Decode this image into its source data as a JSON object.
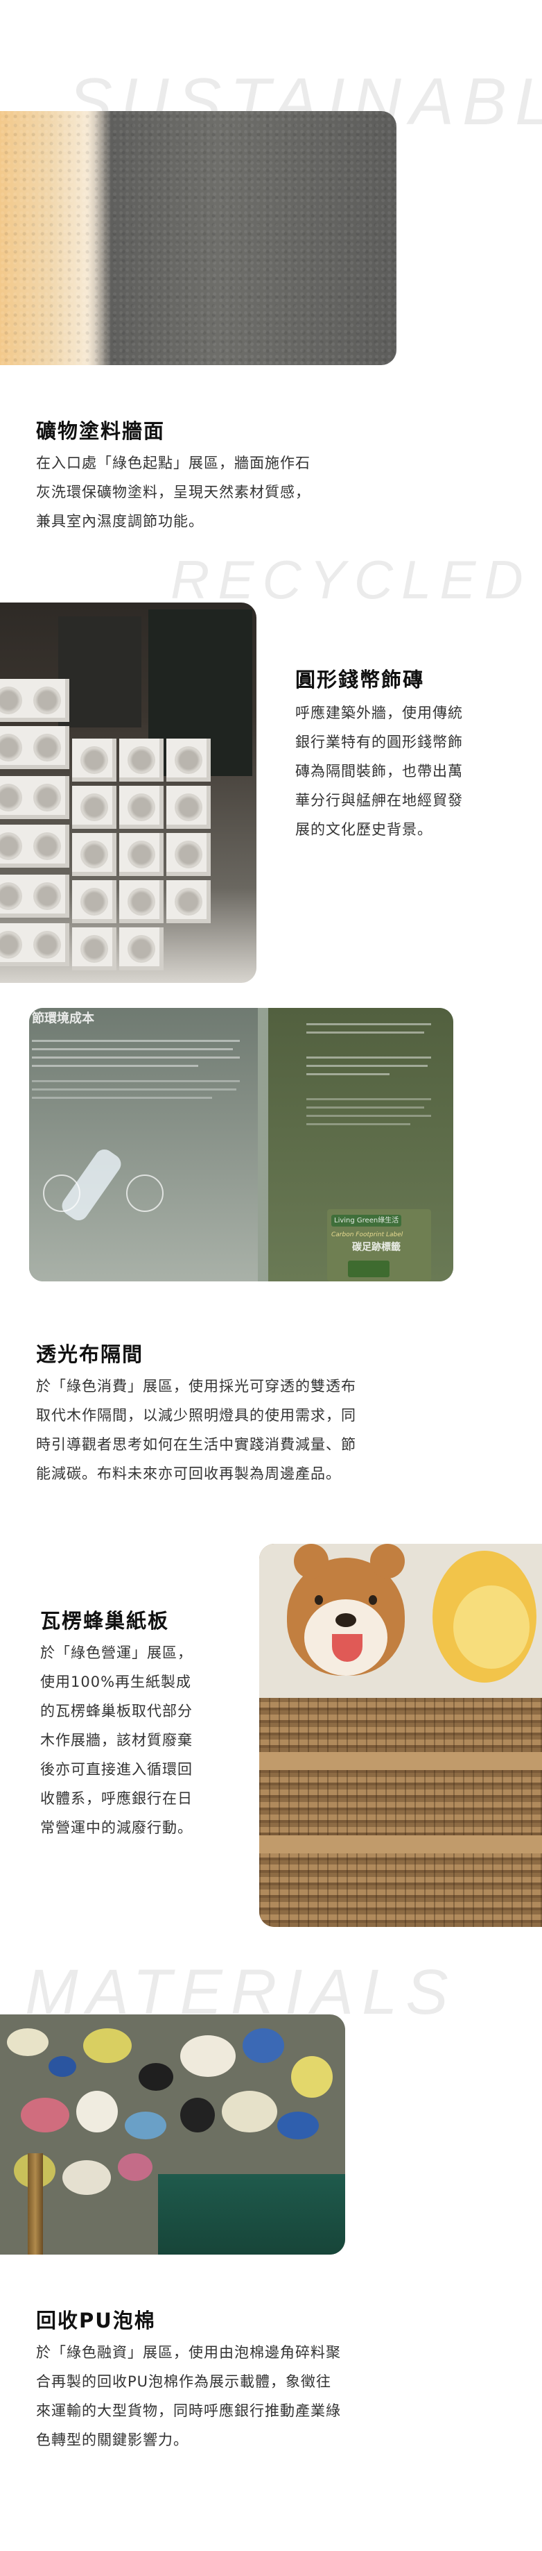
{
  "background_words": [
    "SUSTAINABLE",
    "RECYCLED",
    "MATERIALS"
  ],
  "sections": [
    {
      "title": "礦物塗料牆面",
      "lines": [
        "在入口處「綠色起點」展區，牆面施作石",
        "灰洗環保礦物塗料，呈現天然素材質感，",
        "兼具室內濕度調節功能。"
      ]
    },
    {
      "title": "圓形錢幣飾磚",
      "lines": [
        "呼應建築外牆，使用傳統",
        "銀行業特有的圓形錢幣飾",
        "磚為隔間裝飾，也帶出萬",
        "華分行與艋舺在地經貿發",
        "展的文化歷史背景。"
      ]
    },
    {
      "title": "透光布隔間",
      "lines": [
        "於「綠色消費」展區，使用採光可穿透的雙透布",
        "取代木作隔間，以減少照明燈具的使用需求，同",
        "時引導觀者思考如何在生活中實踐消費減量、節",
        "能減碳。布料未來亦可回收再製為周邊產品。"
      ]
    },
    {
      "title": "瓦楞蜂巢紙板",
      "lines": [
        "於「綠色營運」展區，",
        "使用100%再生紙製成",
        "的瓦楞蜂巢板取代部分",
        "木作展牆，該材質廢棄",
        "後亦可直接進入循環回",
        "收體系，呼應銀行在日",
        "常營運中的減廢行動。"
      ]
    },
    {
      "title": "回收PU泡棉",
      "lines": [
        "於「綠色融資」展區，使用由泡棉邊角碎料聚",
        "合再製的回收PU泡棉作為展示載體，象徵往",
        "來運輸的大型貨物，同時呼應銀行推動產業綠",
        "色轉型的關鍵影響力。"
      ]
    }
  ],
  "panel_photo_text": {
    "heading_fragment": "節環境成本",
    "badge": "Living Green綠生活",
    "badge_sub": "Carbon Footprint Label",
    "label": "碳足跡標籤"
  }
}
